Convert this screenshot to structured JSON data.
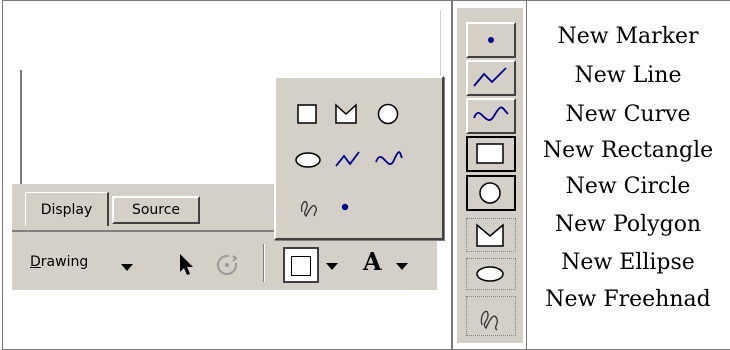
{
  "tabs": {
    "display": "Display",
    "source": "Source"
  },
  "toolbar": {
    "drawing_prefix": "D",
    "drawing_rest": "rawing"
  },
  "popup": {
    "shapes": [
      "rectangle-icon",
      "polygon-icon",
      "circle-icon",
      "ellipse-icon",
      "line-icon",
      "curve-icon",
      "freehand-icon",
      "marker-icon"
    ]
  },
  "vertical_toolbar": {
    "buttons": [
      "marker-icon",
      "line-icon",
      "curve-icon",
      "rectangle-icon",
      "circle-icon",
      "polygon-icon",
      "ellipse-icon",
      "freehand-icon"
    ]
  },
  "labels": [
    "New Marker",
    "New Line",
    "New Curve",
    "New Rectangle",
    "New Circle",
    "New Polygon",
    "New Ellipse",
    "New Freehnad"
  ],
  "colors": {
    "panel": "#d4d0c8",
    "accent_blue": "#00008b"
  }
}
